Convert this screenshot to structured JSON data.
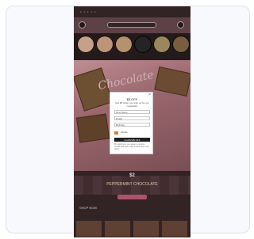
{
  "modal": {
    "close_glyph": "×",
    "title": "$5 OFF",
    "subtitle": "Get $5 when you sign up for our newsletter",
    "fields": [
      {
        "placeholder": "First Name"
      },
      {
        "placeholder": "Email"
      },
      {
        "placeholder": "Birthday"
      }
    ],
    "phone_hint": "Mobile",
    "submit_label": "CLAIM $5 OFF",
    "terms": "By signing up you agree to receive emails and texts. Msg & data rates may apply."
  },
  "app": {
    "hero_script": "Chocolate",
    "hero_caption": "$2",
    "promo_title": "$2",
    "promo_sub": "PEPPERMINT CHOCOLATE",
    "shop_now": "SHOP NOW"
  },
  "colors": {
    "circles": [
      "#e4b59b",
      "#d9a889",
      "#cfa57e",
      "#2a2a2a",
      "#b29a6a",
      "#8a6a4a"
    ]
  },
  "icons": {
    "left": "account-icon",
    "right": "cart-icon"
  }
}
